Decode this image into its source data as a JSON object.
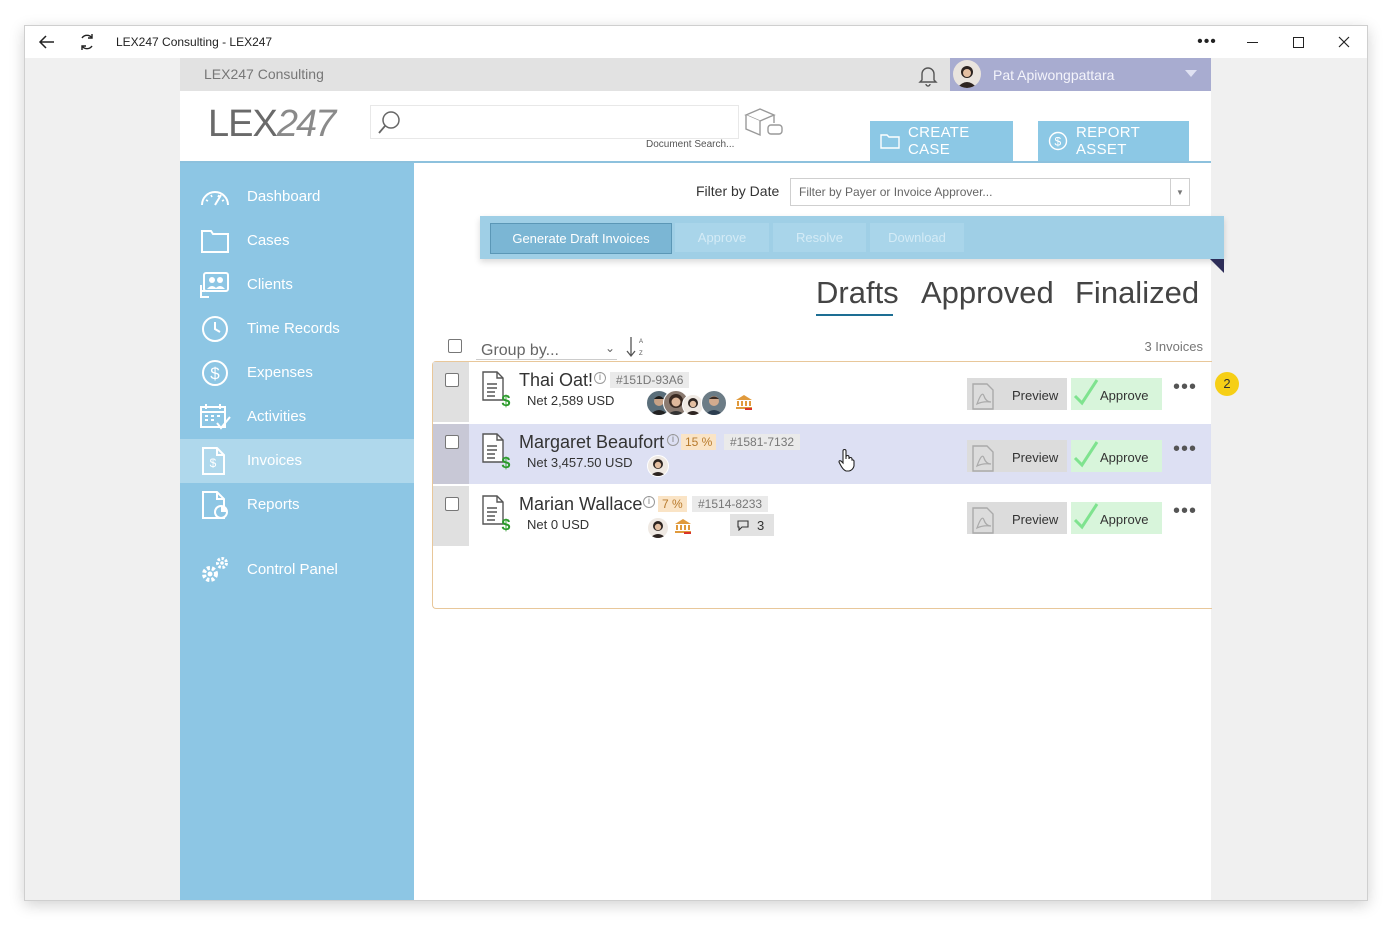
{
  "window": {
    "title": "LEX247 Consulting - LEX247",
    "controls": [
      "more-icon",
      "minimize-icon",
      "maximize-icon",
      "close-icon"
    ]
  },
  "topbar": {
    "org_name": "LEX247 Consulting",
    "user_name": "Pat Apiwongpattara"
  },
  "header": {
    "logo_bold": "LEX",
    "logo_light": "247",
    "search_placeholder": "",
    "search_label": "Document Search...",
    "create_case": "CREATE CASE",
    "report_asset": "REPORT ASSET"
  },
  "sidebar": {
    "items": [
      {
        "label": "Dashboard",
        "icon": "dashboard-icon"
      },
      {
        "label": "Cases",
        "icon": "folder-icon"
      },
      {
        "label": "Clients",
        "icon": "clients-icon"
      },
      {
        "label": "Time Records",
        "icon": "clock-icon"
      },
      {
        "label": "Expenses",
        "icon": "dollar-icon"
      },
      {
        "label": "Activities",
        "icon": "calendar-icon"
      },
      {
        "label": "Invoices",
        "icon": "invoice-icon",
        "active": true
      },
      {
        "label": "Reports",
        "icon": "report-icon"
      },
      {
        "label": "Control Panel",
        "icon": "gears-icon"
      }
    ]
  },
  "filter": {
    "label": "Filter by Date",
    "placeholder": "Filter by Payer or Invoice Approver..."
  },
  "actions": {
    "generate": "Generate Draft Invoices",
    "approve": "Approve",
    "resolve": "Resolve",
    "download": "Download"
  },
  "tabs": {
    "drafts": "Drafts",
    "approved": "Approved",
    "finalized": "Finalized",
    "active": "Drafts"
  },
  "list": {
    "group_by": "Group by...",
    "count": "3 Invoices",
    "rows": [
      {
        "name": "Thai Oat!",
        "percent": "",
        "ref": "#151D-93A6",
        "net": "Net 2,589 USD",
        "preview": "Preview",
        "approve": "Approve",
        "comments": "",
        "badge": "2"
      },
      {
        "name": "Margaret Beaufort",
        "percent": "15 %",
        "ref": "#1581-7132",
        "net": "Net 3,457.50 USD",
        "preview": "Preview",
        "approve": "Approve",
        "comments": ""
      },
      {
        "name": "Marian Wallace",
        "percent": "7 %",
        "ref": "#1514-8233",
        "net": "Net 0 USD",
        "preview": "Preview",
        "approve": "Approve",
        "comments": "3"
      }
    ]
  },
  "colors": {
    "sidebar": "#8dc6e4",
    "sidebar_active": "#afd8ec",
    "user_bar": "#a8acd0",
    "approve_bg": "#d8f5db",
    "approve_check": "#7fe38f",
    "tab_underline": "#1d6e93"
  }
}
